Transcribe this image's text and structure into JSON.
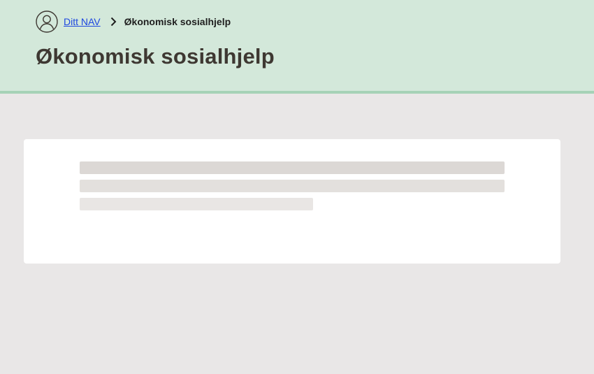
{
  "header": {
    "breadcrumb": {
      "avatar_icon": "user-circle-icon",
      "home_link": "Ditt NAV",
      "separator_icon": "chevron-right-icon",
      "current": "Økonomisk sosialhjelp"
    },
    "title": "Økonomisk sosialhjelp"
  },
  "main": {
    "loading_card": {
      "skeleton_lines": 3
    }
  },
  "colors": {
    "header_bg": "#d3e8da",
    "header_border": "#a6d2b7",
    "page_bg": "#e9e7e7",
    "link": "#1d47e0",
    "title": "#3e3832",
    "card_bg": "#ffffff",
    "skeleton": "#dcd8d5"
  }
}
